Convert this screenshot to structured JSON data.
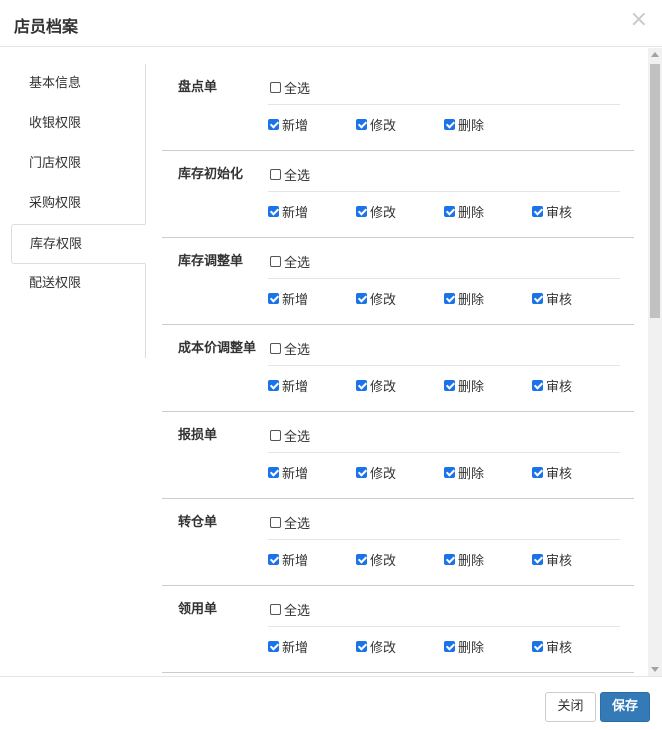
{
  "dialog": {
    "title": "店员档案",
    "close_glyph": "×"
  },
  "tabs": [
    {
      "label": "基本信息",
      "active": false
    },
    {
      "label": "收银权限",
      "active": false
    },
    {
      "label": "门店权限",
      "active": false
    },
    {
      "label": "采购权限",
      "active": false
    },
    {
      "label": "库存权限",
      "active": true
    },
    {
      "label": "配送权限",
      "active": false
    }
  ],
  "select_all_label": "全选",
  "sections": [
    {
      "title": "盘点单",
      "select_all": false,
      "options": [
        {
          "label": "新增",
          "checked": true
        },
        {
          "label": "修改",
          "checked": true
        },
        {
          "label": "删除",
          "checked": true
        }
      ]
    },
    {
      "title": "库存初始化",
      "select_all": false,
      "options": [
        {
          "label": "新增",
          "checked": true
        },
        {
          "label": "修改",
          "checked": true
        },
        {
          "label": "删除",
          "checked": true
        },
        {
          "label": "审核",
          "checked": true
        }
      ]
    },
    {
      "title": "库存调整单",
      "select_all": false,
      "options": [
        {
          "label": "新增",
          "checked": true
        },
        {
          "label": "修改",
          "checked": true
        },
        {
          "label": "删除",
          "checked": true
        },
        {
          "label": "审核",
          "checked": true
        }
      ]
    },
    {
      "title": "成本价调整单",
      "select_all": false,
      "options": [
        {
          "label": "新增",
          "checked": true
        },
        {
          "label": "修改",
          "checked": true
        },
        {
          "label": "删除",
          "checked": true
        },
        {
          "label": "审核",
          "checked": true
        }
      ]
    },
    {
      "title": "报损单",
      "select_all": false,
      "options": [
        {
          "label": "新增",
          "checked": true
        },
        {
          "label": "修改",
          "checked": true
        },
        {
          "label": "删除",
          "checked": true
        },
        {
          "label": "审核",
          "checked": true
        }
      ]
    },
    {
      "title": "转仓单",
      "select_all": false,
      "options": [
        {
          "label": "新增",
          "checked": true
        },
        {
          "label": "修改",
          "checked": true
        },
        {
          "label": "删除",
          "checked": true
        },
        {
          "label": "审核",
          "checked": true
        }
      ]
    },
    {
      "title": "领用单",
      "select_all": false,
      "options": [
        {
          "label": "新增",
          "checked": true
        },
        {
          "label": "修改",
          "checked": true
        },
        {
          "label": "删除",
          "checked": true
        },
        {
          "label": "审核",
          "checked": true
        }
      ]
    }
  ],
  "footer": {
    "close_label": "关闭",
    "save_label": "保存"
  },
  "colors": {
    "primary": "#337ab7",
    "checkbox": "#1a73e8"
  }
}
